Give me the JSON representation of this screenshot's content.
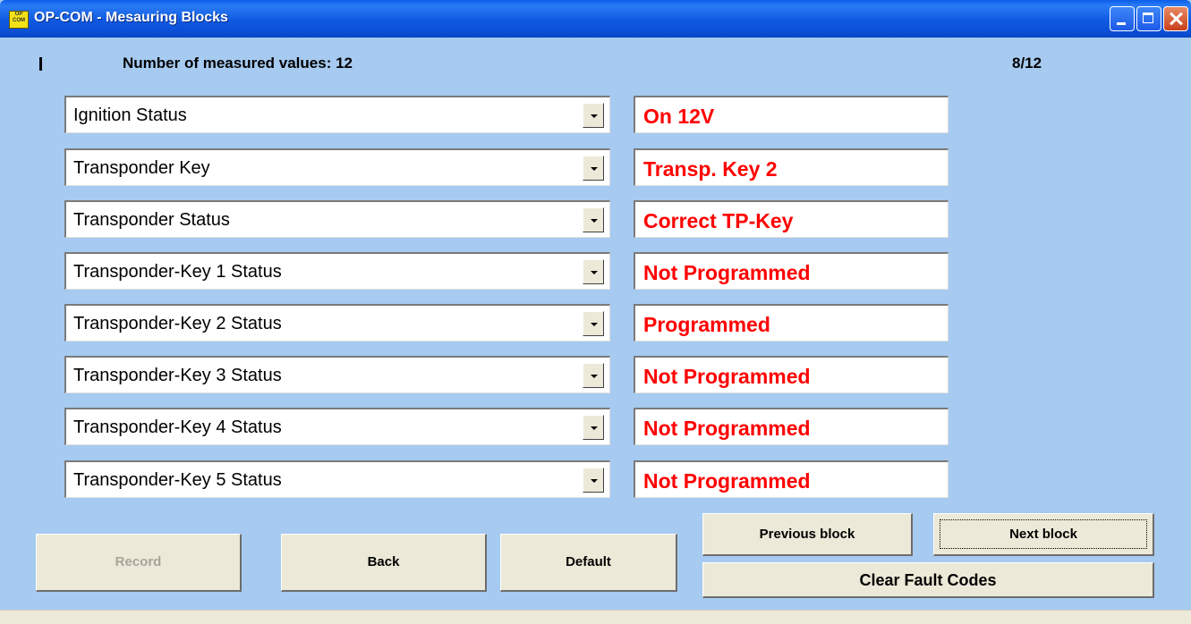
{
  "window": {
    "title": "OP-COM - Mesauring Blocks",
    "icon_name": "op-com-app-icon",
    "icon_text": "OP COM"
  },
  "header": {
    "count_label": "Number of measured values: 12",
    "page_indicator": "8/12"
  },
  "rows": [
    {
      "parameter": "Ignition Status",
      "value": "On  12V"
    },
    {
      "parameter": "Transponder Key",
      "value": "Transp. Key 2"
    },
    {
      "parameter": "Transponder Status",
      "value": "Correct TP-Key"
    },
    {
      "parameter": "Transponder-Key 1 Status",
      "value": "Not Programmed"
    },
    {
      "parameter": "Transponder-Key 2 Status",
      "value": "Programmed"
    },
    {
      "parameter": "Transponder-Key 3 Status",
      "value": "Not Programmed"
    },
    {
      "parameter": "Transponder-Key 4 Status",
      "value": "Not Programmed"
    },
    {
      "parameter": "Transponder-Key 5 Status",
      "value": "Not Programmed"
    }
  ],
  "buttons": {
    "record": "Record",
    "back": "Back",
    "default": "Default",
    "previous_block": "Previous block",
    "next_block": "Next block",
    "clear_fault_codes": "Clear Fault Codes"
  },
  "colors": {
    "window_bg": "#a6caf0",
    "value_text": "#ff0000",
    "titlebar": "#0a5ee8"
  }
}
